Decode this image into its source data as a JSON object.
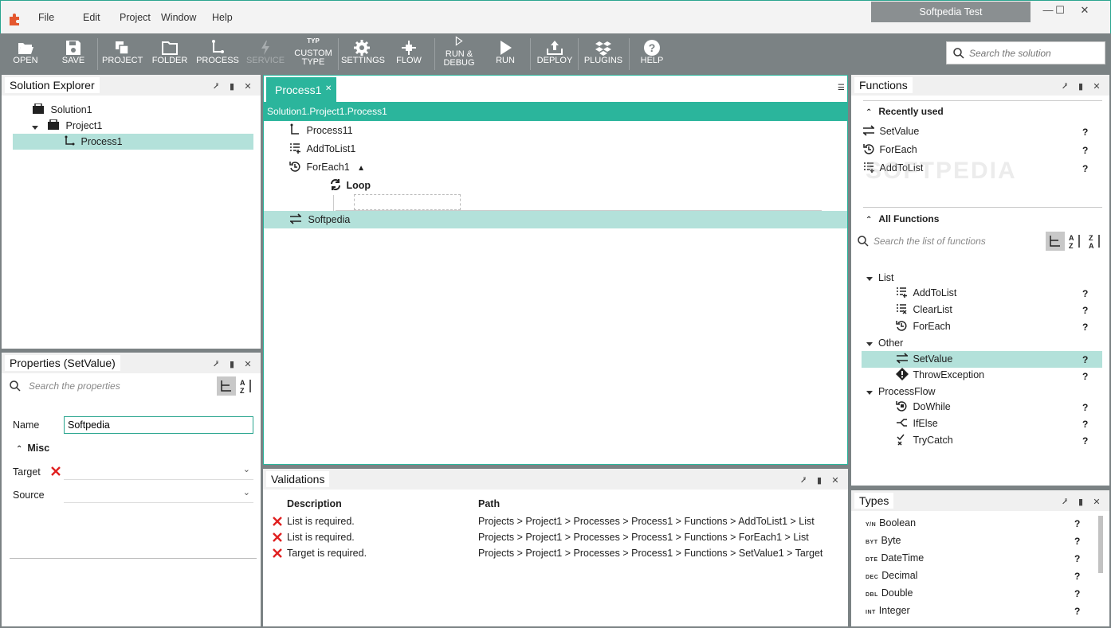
{
  "menu": {
    "items": [
      "File",
      "Edit",
      "Project",
      "Window",
      "Help"
    ]
  },
  "window": {
    "title": "Softpedia Test",
    "minimize": "—",
    "maximize": "☐",
    "close": "✕"
  },
  "toolbar": {
    "buttons": [
      {
        "label": "OPEN",
        "icon": "folder-open-icon"
      },
      {
        "label": "SAVE",
        "icon": "save-icon"
      },
      {
        "label": "PROJECT",
        "icon": "project-icon"
      },
      {
        "label": "FOLDER",
        "icon": "folder-icon"
      },
      {
        "label": "PROCESS",
        "icon": "process-icon"
      },
      {
        "label": "SERVICE",
        "icon": "service-icon",
        "disabled": true
      },
      {
        "label": "CUSTOM",
        "label2": "TYPE",
        "badge": "TYP",
        "icon": "custom-type-icon"
      },
      {
        "label": "SETTINGS",
        "icon": "gear-icon"
      },
      {
        "label": "FLOW",
        "icon": "flow-icon"
      },
      {
        "label": "RUN &",
        "label2": "DEBUG",
        "icon": "run-debug-icon"
      },
      {
        "label": "RUN",
        "icon": "play-icon"
      },
      {
        "label": "DEPLOY",
        "icon": "deploy-icon"
      },
      {
        "label": "PLUGINS",
        "icon": "plugins-icon"
      },
      {
        "label": "HELP",
        "icon": "help-icon"
      }
    ],
    "search_placeholder": "Search the solution"
  },
  "solution_explorer": {
    "title": "Solution Explorer",
    "items": [
      "Solution1",
      "Project1",
      "Process1"
    ]
  },
  "properties": {
    "title": "Properties (SetValue)",
    "search_placeholder": "Search the properties",
    "name_label": "Name",
    "name_value": "Softpedia",
    "section": "Misc",
    "target_label": "Target",
    "source_label": "Source"
  },
  "editor": {
    "tab": "Process1",
    "tab_close": "✕",
    "breadcrumb": "Solution1.Project1.Process1",
    "rows": [
      "Process11",
      "AddToList1",
      "ForEach1",
      "Loop",
      "Softpedia"
    ],
    "expand_glyph": "▲"
  },
  "validations": {
    "title": "Validations",
    "columns": [
      "Description",
      "Path"
    ],
    "rows": [
      {
        "description": "List is required.",
        "path": "Projects > Project1 > Processes > Process1 > Functions > AddToList1 > List"
      },
      {
        "description": "List is required.",
        "path": "Projects > Project1 > Processes > Process1 > Functions > ForEach1 > List"
      },
      {
        "description": "Target is required.",
        "path": "Projects > Project1 > Processes > Process1 > Functions > SetValue1 > Target"
      }
    ]
  },
  "functions": {
    "title": "Functions",
    "recently_used_label": "Recently used",
    "recently_used": [
      "SetValue",
      "ForEach",
      "AddToList"
    ],
    "all_label": "All Functions",
    "search_placeholder": "Search the list of functions",
    "groups": [
      {
        "name": "List",
        "items": [
          "AddToList",
          "ClearList",
          "ForEach"
        ]
      },
      {
        "name": "Other",
        "items": [
          "SetValue",
          "ThrowException"
        ]
      },
      {
        "name": "ProcessFlow",
        "items": [
          "DoWhile",
          "IfElse",
          "TryCatch"
        ]
      }
    ],
    "help": "?",
    "watermark": "SOFTPEDIA"
  },
  "types": {
    "title": "Types",
    "items": [
      {
        "name": "Boolean",
        "badge": "Y/N"
      },
      {
        "name": "Byte",
        "badge": "BYT"
      },
      {
        "name": "DateTime",
        "badge": "DTE"
      },
      {
        "name": "Decimal",
        "badge": "DEC"
      },
      {
        "name": "Double",
        "badge": "DBL"
      },
      {
        "name": "Integer",
        "badge": "INT"
      }
    ]
  },
  "colors": {
    "accent": "#2bb59c",
    "toolbar": "#7b8284",
    "selection": "#b3e1da",
    "error": "#e02020"
  }
}
